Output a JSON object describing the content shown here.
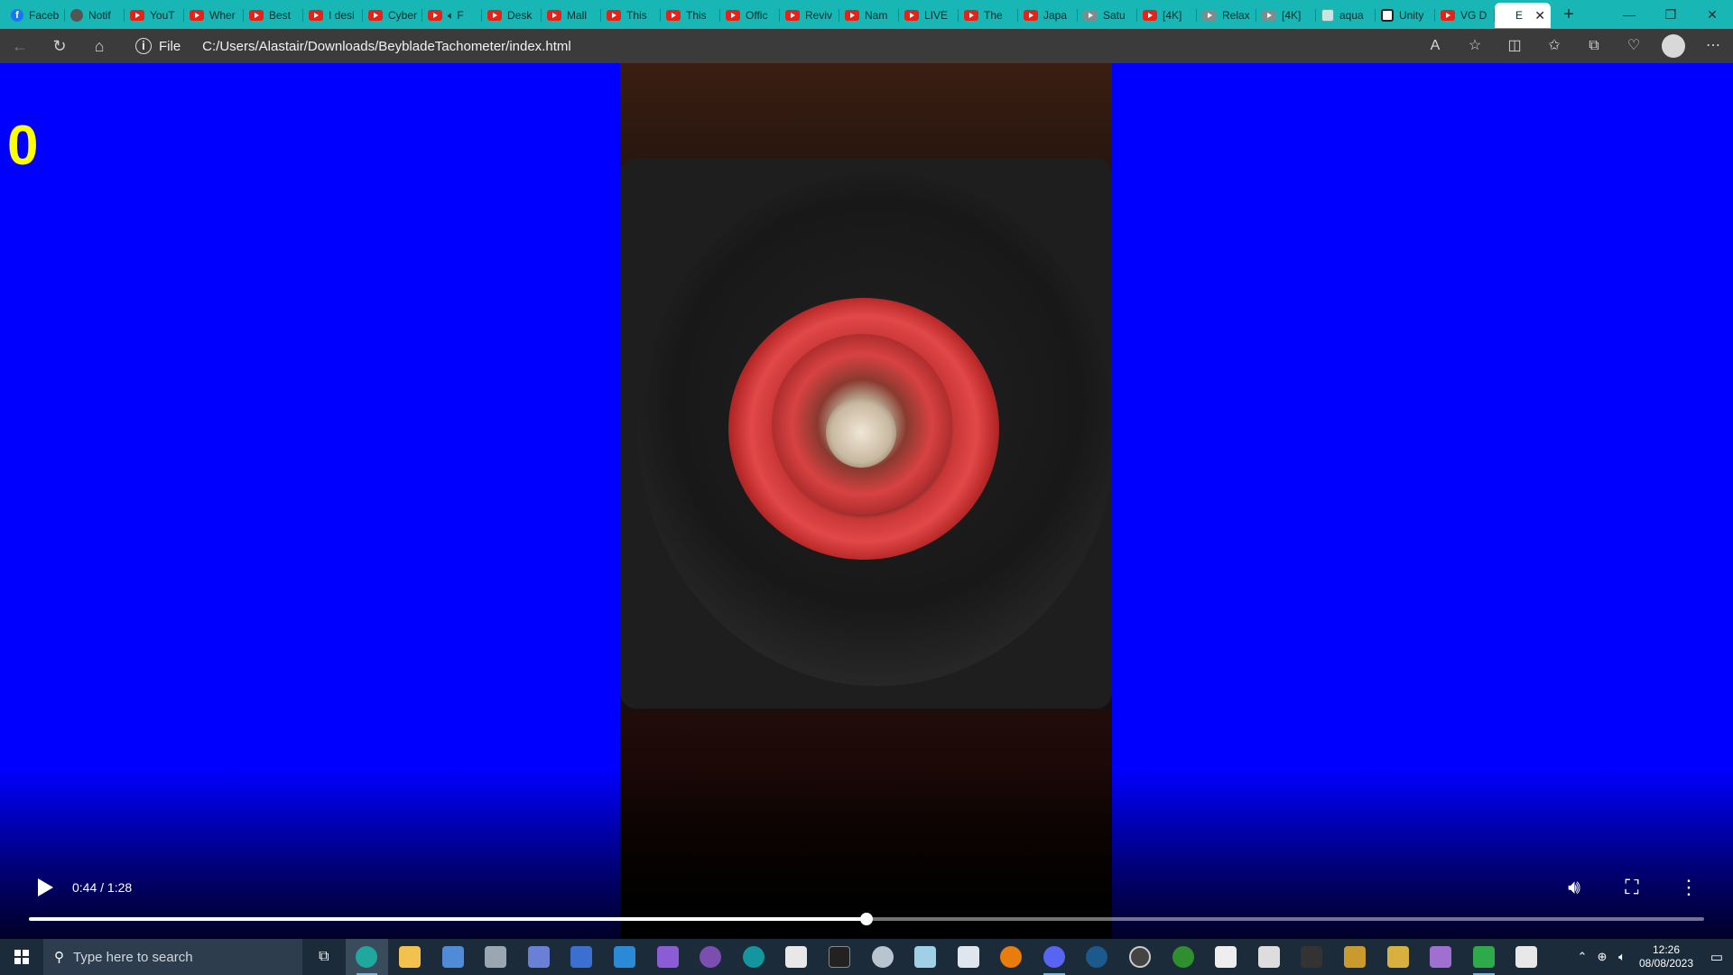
{
  "browser": {
    "tabs": [
      {
        "label": "Faceb",
        "icon": "facebook"
      },
      {
        "label": "Notif",
        "icon": "github"
      },
      {
        "label": "YouT",
        "icon": "youtube"
      },
      {
        "label": "Wher",
        "icon": "youtube"
      },
      {
        "label": "Best",
        "icon": "youtube"
      },
      {
        "label": "I desi",
        "icon": "youtube"
      },
      {
        "label": "Cyber",
        "icon": "youtube"
      },
      {
        "label": "F",
        "icon": "youtube",
        "audio": true
      },
      {
        "label": "Desk",
        "icon": "youtube"
      },
      {
        "label": "Mall",
        "icon": "youtube"
      },
      {
        "label": "This",
        "icon": "youtube"
      },
      {
        "label": "This",
        "icon": "youtube"
      },
      {
        "label": "Offic",
        "icon": "youtube"
      },
      {
        "label": "Reviv",
        "icon": "youtube"
      },
      {
        "label": "Nam",
        "icon": "youtube"
      },
      {
        "label": "LIVE",
        "icon": "youtube"
      },
      {
        "label": "The",
        "icon": "youtube"
      },
      {
        "label": "Japa",
        "icon": "youtube"
      },
      {
        "label": "Satu",
        "icon": "youtube-dim"
      },
      {
        "label": "[4K]",
        "icon": "youtube"
      },
      {
        "label": "Relax",
        "icon": "youtube-dim"
      },
      {
        "label": "[4K]",
        "icon": "youtube-dim"
      },
      {
        "label": "aqua",
        "icon": "web"
      },
      {
        "label": "Unity",
        "icon": "unity"
      },
      {
        "label": "VG D",
        "icon": "youtube"
      }
    ],
    "active_tab": {
      "label": "E",
      "icon": "page"
    },
    "new_tab_label": "+",
    "address": {
      "scheme_label": "File",
      "url": "C:/Users/Alastair/Downloads/BeybladeTachometer/index.html"
    }
  },
  "page": {
    "counter_value": "0",
    "background_color": "#0000ff",
    "counter_color": "#ffff00"
  },
  "video": {
    "current_time": "0:44",
    "duration": "1:28",
    "time_display": "0:44 / 1:28",
    "progress_fraction": 0.5
  },
  "taskbar": {
    "search_placeholder": "Type here to search",
    "clock_time": "12:26",
    "clock_date": "08/08/2023"
  },
  "colors": {
    "tabstrip": "#18b6b4",
    "toolbar": "#3b3b3b",
    "taskbar": "#1c2b3a"
  }
}
